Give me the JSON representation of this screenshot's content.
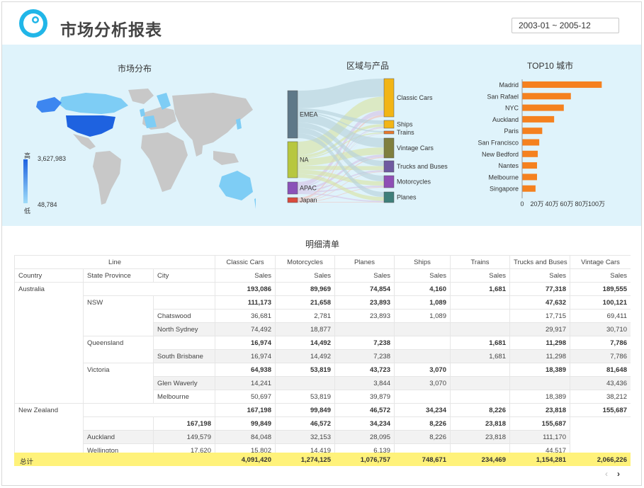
{
  "header": {
    "title": "市场分析报表",
    "date_range": "2003-01 ~ 2005-12"
  },
  "map_panel": {
    "title": "市场分布",
    "legend_high": "高",
    "legend_low": "低",
    "legend_max": "3,627,983",
    "legend_min": "48,784"
  },
  "sankey_panel": {
    "title": "区域与产品",
    "regions": [
      "EMEA",
      "NA",
      "APAC",
      "Japan"
    ],
    "products": [
      "Classic Cars",
      "Ships",
      "Trains",
      "Vintage Cars",
      "Trucks and Buses",
      "Motorcycles",
      "Planes"
    ],
    "colors": {
      "EMEA": "#5e7888",
      "NA": "#b7c73f",
      "APAC": "#8a52b8",
      "Japan": "#d94b3d",
      "Classic Cars": "#f2b516",
      "Ships": "#f2b516",
      "Trains": "#e8782b",
      "Vintage Cars": "#7f7f3f",
      "Trucks and Buses": "#6f5aa0",
      "Motorcycles": "#8f4fb5",
      "Planes": "#3f7f7a"
    }
  },
  "chart_data": {
    "type": "bar",
    "title": "TOP10 城市",
    "orientation": "horizontal",
    "categories": [
      "Madrid",
      "San Rafael",
      "NYC",
      "Auckland",
      "Paris",
      "San Francisco",
      "New Bedford",
      "Nantes",
      "Melbourne",
      "Singapore"
    ],
    "values": [
      1070000,
      655000,
      560000,
      430000,
      270000,
      230000,
      210000,
      200000,
      200000,
      180000
    ],
    "xlim": [
      0,
      1000000
    ],
    "xticks": [
      "0",
      "20万",
      "40万",
      "60万",
      "80万",
      "100万"
    ],
    "color": "#f5811f",
    "grid": false
  },
  "table": {
    "title": "明细清单",
    "line_header": "Line",
    "dim_headers": [
      "Country",
      "State Province",
      "City"
    ],
    "products": [
      "Classic Cars",
      "Motorcycles",
      "Planes",
      "Ships",
      "Trains",
      "Trucks and Buses",
      "Vintage Cars"
    ],
    "measure": "Sales",
    "rows": [
      {
        "country": "Australia",
        "state": "",
        "city": "",
        "bold": true,
        "shade": false,
        "values": [
          "193,086",
          "89,969",
          "74,854",
          "4,160",
          "1,681",
          "77,318",
          "189,555"
        ]
      },
      {
        "country": "",
        "state": "NSW",
        "city": "",
        "bold": true,
        "shade": false,
        "values": [
          "111,173",
          "21,658",
          "23,893",
          "1,089",
          "",
          "47,632",
          "100,121"
        ]
      },
      {
        "country": "",
        "state": "",
        "city": "Chatswood",
        "bold": false,
        "shade": false,
        "values": [
          "36,681",
          "2,781",
          "23,893",
          "1,089",
          "",
          "17,715",
          "69,411"
        ]
      },
      {
        "country": "",
        "state": "",
        "city": "North Sydney",
        "bold": false,
        "shade": true,
        "values": [
          "74,492",
          "18,877",
          "",
          "",
          "",
          "29,917",
          "30,710"
        ]
      },
      {
        "country": "",
        "state": "Queensland",
        "city": "",
        "bold": true,
        "shade": false,
        "values": [
          "16,974",
          "14,492",
          "7,238",
          "",
          "1,681",
          "11,298",
          "7,786"
        ]
      },
      {
        "country": "",
        "state": "",
        "city": "South Brisbane",
        "bold": false,
        "shade": true,
        "values": [
          "16,974",
          "14,492",
          "7,238",
          "",
          "1,681",
          "11,298",
          "7,786"
        ]
      },
      {
        "country": "",
        "state": "Victoria",
        "city": "",
        "bold": true,
        "shade": false,
        "values": [
          "64,938",
          "53,819",
          "43,723",
          "3,070",
          "",
          "18,389",
          "81,648"
        ]
      },
      {
        "country": "",
        "state": "",
        "city": "Glen Waverly",
        "bold": false,
        "shade": true,
        "values": [
          "14,241",
          "",
          "3,844",
          "3,070",
          "",
          "",
          "43,436"
        ]
      },
      {
        "country": "",
        "state": "",
        "city": "Melbourne",
        "bold": false,
        "shade": false,
        "values": [
          "50,697",
          "53,819",
          "39,879",
          "",
          "",
          "18,389",
          "38,212"
        ]
      },
      {
        "country": "New Zealand",
        "state": "",
        "city": "",
        "bold": true,
        "shade": false,
        "values": [
          "167,198",
          "99,849",
          "46,572",
          "34,234",
          "8,226",
          "23,818",
          "155,687"
        ]
      },
      {
        "country": "",
        "state": "",
        "city": "",
        "bold": true,
        "shade": false,
        "values": [
          "167,198",
          "99,849",
          "46,572",
          "34,234",
          "8,226",
          "23,818",
          "155,687"
        ]
      },
      {
        "country": "",
        "state": "",
        "city": "Auckland",
        "bold": false,
        "shade": true,
        "values": [
          "149,579",
          "84,048",
          "32,153",
          "28,095",
          "8,226",
          "23,818",
          "111,170"
        ]
      },
      {
        "country": "",
        "state": "",
        "city": "Wellington",
        "bold": false,
        "shade": false,
        "values": [
          "17,620",
          "15,802",
          "14,419",
          "6,139",
          "",
          "",
          "44,517"
        ]
      }
    ],
    "total": {
      "label": "总计",
      "values": [
        "4,091,420",
        "1,274,125",
        "1,076,757",
        "748,671",
        "234,469",
        "1,154,281",
        "2,066,226"
      ]
    }
  },
  "pager": {
    "prev": "‹",
    "next": "›"
  }
}
